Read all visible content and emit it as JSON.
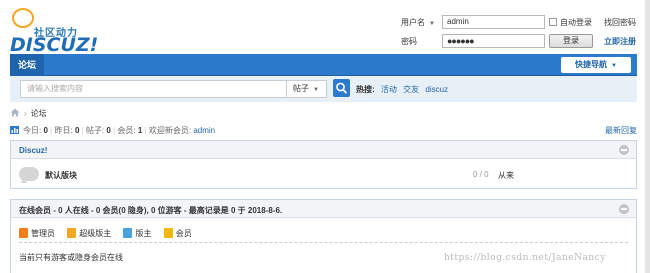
{
  "logo": {
    "slogan": "社区动力",
    "brand": "DISCUZ!"
  },
  "login": {
    "username_label": "用户名",
    "username_value": "admin",
    "autologin_label": "自动登录",
    "find_password": "找回密码",
    "password_label": "密码",
    "password_value": "●●●●●●",
    "login_button": "登录",
    "register": "立即注册"
  },
  "nav": {
    "tab": "论坛",
    "quick": "快捷导航"
  },
  "search": {
    "placeholder": "请输入搜索内容",
    "type": "帖子",
    "hot_label": "热搜:",
    "hot_words": [
      "活动",
      "交友",
      "discuz"
    ]
  },
  "breadcrumb": {
    "current": "论坛"
  },
  "stats": {
    "today_label": "今日:",
    "today": "0",
    "yesterday_label": "昨日:",
    "yesterday": "0",
    "posts_label": "帖子:",
    "posts": "0",
    "members_label": "会员:",
    "members": "1",
    "welcome": "欢迎新会员:",
    "new_member": "admin",
    "latest_reply": "最新回复"
  },
  "category": {
    "title": "Discuz!",
    "forum": {
      "name": "默认版块",
      "count": "0 / 0",
      "last": "从来"
    }
  },
  "online": {
    "title": "在线会员 - 0 人在线 - 0 会员(0 隐身), 0 位游客 - 最高记录是 0 于 2018-8-6.",
    "legend": [
      "管理员",
      "超级版主",
      "版主",
      "会员"
    ],
    "note": "当前只有游客或隐身会员在线"
  },
  "watermark": "https://blog.csdn.net/JaneNancy",
  "colors": {
    "accent": "#2b7acc",
    "link": "#2366a8",
    "admin": "#f07f1b",
    "super_mod": "#f5a623",
    "mod": "#4aa3df",
    "member": "#f5b800"
  }
}
